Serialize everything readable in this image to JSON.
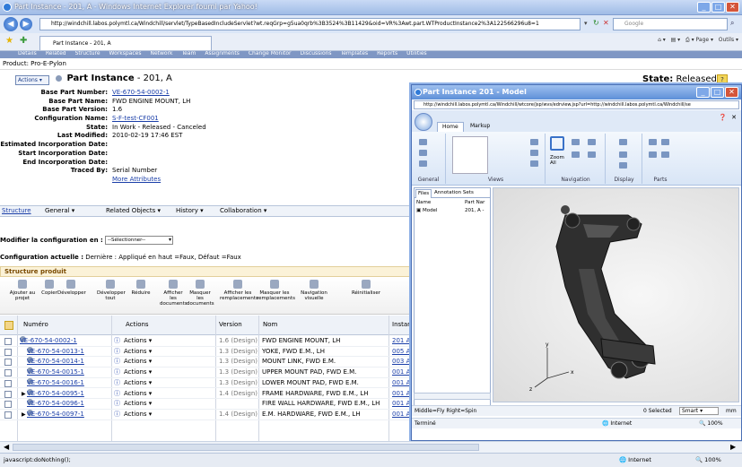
{
  "browser": {
    "title": "Part Instance - 201, A - Windows Internet Explorer fourni par Yahoo!",
    "url": "http://windchill.labos.polymtl.ca/Windchill/servlet/TypeBasedIncludeServlet?wt.reqGrp=g5ua0qrb%3B3524%3B11429&oid=VR%3Awt.part.WTProductInstance2%3A122566296u8=1",
    "search_placeholder": "Google",
    "tab_label": "Part Instance - 201, A",
    "tools_page": "Page ▾",
    "tools_outils": "Outils ▾",
    "status_text": "javascript:doNothing();",
    "zone": "Internet",
    "zoom": "100%"
  },
  "menu": [
    "Details",
    "Related",
    "Structure",
    "Workspaces",
    "Network",
    "Team",
    "Assignments",
    "Change Monitor",
    "Discussions",
    "Templates",
    "Reports",
    "Utilities"
  ],
  "product": "Product: Pro-E-Pylon",
  "header": {
    "actions": "Actions ▾",
    "title_bold": "Part Instance",
    "title_rest": " - 201, A",
    "state_label": "State:",
    "state_value": " Released",
    "help": "?"
  },
  "attributes": [
    {
      "k": "Base Part Number:",
      "v": "VE-670-54-0002-1",
      "link": true
    },
    {
      "k": "Base Part Name:",
      "v": "FWD ENGINE MOUNT, LH",
      "link": false
    },
    {
      "k": "Base Part Version:",
      "v": "1.6",
      "link": false
    },
    {
      "k": "Configuration Name:",
      "v": "S-F-test-CF001",
      "link": true
    },
    {
      "k": "State:",
      "v": "In Work - Released - Canceled",
      "link": false
    },
    {
      "k": "Last Modified:",
      "v": "2010-02-19 17:46 EST",
      "link": false
    },
    {
      "k": "Estimated Incorporation Date:",
      "v": "",
      "link": false
    },
    {
      "k": "Start Incorporation Date:",
      "v": "",
      "link": false
    },
    {
      "k": "End Incorporation Date:",
      "v": "",
      "link": false
    },
    {
      "k": "Traced By:",
      "v": "Serial Number",
      "link": false
    },
    {
      "k": "",
      "v": "More Attributes",
      "link": true
    }
  ],
  "tabs": [
    "Structure",
    "General ▾",
    "Related Objects ▾",
    "History ▾",
    "Collaboration ▾"
  ],
  "config": {
    "modify_label": "Modifier la configuration en :",
    "select_value": "--Sélectionner--",
    "current_label": "Configuration actuelle :",
    "current_value": " Dernière : Appliqué en haut =Faux, Défaut =Faux"
  },
  "structure": {
    "title": "Structure produit",
    "tools": [
      "Ajouter au projet",
      "Copier",
      "Développer",
      "Développer tout",
      "Réduire",
      "Afficher les documents",
      "Masquer les documents",
      "Afficher les remplacements",
      "Masquer les remplacements",
      "Navigation visuelle",
      "Réinitialiser"
    ],
    "columns": [
      "Numéro",
      "Actions",
      "Version",
      "Nom",
      "Instanc"
    ],
    "rows": [
      {
        "num": "VE-670-54-0002-1",
        "actions": "Actions ▾",
        "version": "1.6 (Design)",
        "name": "FWD ENGINE MOUNT, LH",
        "inst": "201 A"
      },
      {
        "num": "VE-670-54-0013-1",
        "actions": "Actions ▾",
        "version": "1.3 (Design)",
        "name": "YOKE, FWD E.M., LH",
        "inst": "005 A"
      },
      {
        "num": "VE-670-54-0014-1",
        "actions": "Actions ▾",
        "version": "1.3 (Design)",
        "name": "MOUNT LINK, FWD E.M.",
        "inst": "003 A"
      },
      {
        "num": "VE-670-54-0015-1",
        "actions": "Actions ▾",
        "version": "1.3 (Design)",
        "name": "UPPER MOUNT PAD, FWD E.M.",
        "inst": "001 A"
      },
      {
        "num": "VE-670-54-0016-1",
        "actions": "Actions ▾",
        "version": "1.3 (Design)",
        "name": "LOWER MOUNT PAD, FWD E.M.",
        "inst": "001 A"
      },
      {
        "num": "VE-670-54-0095-1",
        "actions": "Actions ▾",
        "version": "1.4 (Design)",
        "name": "FRAME HARDWARE, FWD E.M., LH",
        "inst": "001 A"
      },
      {
        "num": "VE-670-54-0096-1",
        "actions": "Actions ▾",
        "version": "",
        "name": "FIRE WALL HARDWARE, FWD E.M., LH",
        "inst": "001 A"
      },
      {
        "num": "VE-670-54-0097-1",
        "actions": "Actions ▾",
        "version": "1.4 (Design)",
        "name": "E.M. HARDWARE, FWD E.M., LH",
        "inst": "001 A"
      }
    ]
  },
  "viewer": {
    "title": "Part Instance 201 - Model",
    "url": "http://windchill.labos.polymtl.ca/Windchill/wtcore/jsp/wvs/edrview.jsp?url=http://windchill.labos.polymtl.ca/Windchill/se",
    "tabs": [
      "Home",
      "Markup"
    ],
    "groups": [
      "General",
      "Views",
      "Navigation",
      "Display",
      "Parts"
    ],
    "zoom_all": "Zoom All",
    "pane_tabs": [
      "Files",
      "Annotation Sets"
    ],
    "pane_cols": [
      "Name",
      "Part Nar"
    ],
    "pane_row": {
      "name": "Model",
      "part": "201, A -"
    },
    "nav_hint": "Middle=Fly Right=Spin",
    "selected": "0 Selected",
    "mode": "Smart",
    "unit": "mm",
    "status": "Terminé",
    "zone": "Internet",
    "zoom": "100%"
  }
}
